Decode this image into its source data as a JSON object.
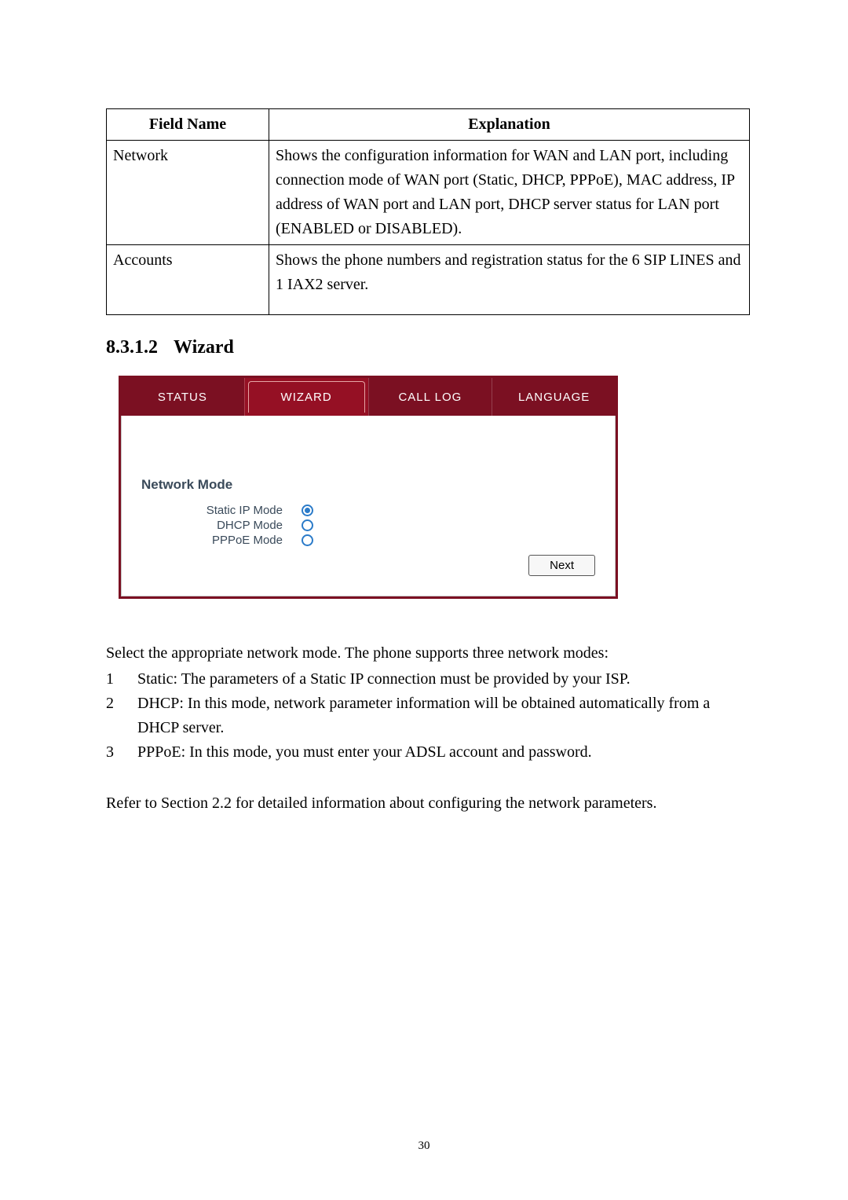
{
  "table": {
    "headers": {
      "field": "Field Name",
      "explanation": "Explanation"
    },
    "rows": [
      {
        "field": "Network",
        "explanation": "Shows the configuration information for WAN and LAN port, including connection mode of WAN port (Static, DHCP, PPPoE), MAC address, IP address of WAN port and LAN port, DHCP server status for LAN port (ENABLED or DISABLED)."
      },
      {
        "field": "Accounts",
        "explanation": "Shows the phone numbers and registration status for the 6 SIP LINES and 1 IAX2 server."
      }
    ]
  },
  "section": {
    "number": "8.3.1.2",
    "title": "Wizard"
  },
  "wizard": {
    "tabs": {
      "status": "STATUS",
      "wizard": "WIZARD",
      "calllog": "CALL LOG",
      "language": "LANGUAGE"
    },
    "panel_title": "Network Mode",
    "options": {
      "static": "Static IP Mode",
      "dhcp": "DHCP Mode",
      "pppoe": "PPPoE Mode"
    },
    "selected": "static",
    "next": "Next"
  },
  "body": {
    "intro": "Select the appropriate network mode.   The phone supports three network modes:",
    "items": [
      {
        "n": "1",
        "t": "Static: The parameters of a Static IP connection must be provided by your ISP."
      },
      {
        "n": "2",
        "t": "DHCP: In this mode, network parameter information will be obtained automatically from a DHCP server."
      },
      {
        "n": "3",
        "t": "PPPoE: In this mode, you must enter your ADSL account and password."
      }
    ],
    "outro": "Refer to Section 2.2 for detailed information about configuring the network parameters."
  },
  "page_number": "30"
}
